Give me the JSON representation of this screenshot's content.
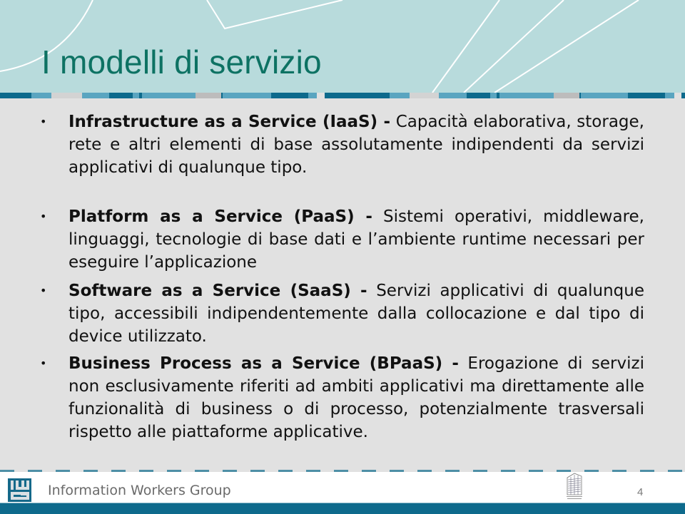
{
  "slide": {
    "title": "I modelli di servizio",
    "bullets": [
      {
        "bold": "Infrastructure as a Service (IaaS) -",
        "text": " Capacità elaborativa, storage, rete e altri elementi di base assolutamente indipendenti da servizi applicativi di qualunque tipo."
      },
      {
        "bold": "Platform as a Service (PaaS)  -",
        "text": " Sistemi operativi, middleware, linguaggi, tecnologie di base dati e l’ambiente runtime necessari per eseguire l’applicazione"
      },
      {
        "bold": "Software as a Service (SaaS) -",
        "text": " Servizi applicativi di qualunque tipo, accessibili indipendentemente dalla collocazione e dal tipo di device utilizzato."
      },
      {
        "bold": "Business Process as a Service (BPaaS) -",
        "text": " Erogazione di servizi non esclusivamente riferiti ad ambiti applicativi ma direttamente alle funzionalità di business o di processo, potenzialmente trasversali rispetto alle piattaforme applicative."
      }
    ],
    "bullet_glyph": "•"
  },
  "footer": {
    "brand": "Information Workers Group",
    "logo_icon": "iwg-logo-icon",
    "building_icon": "building-icon",
    "page_number": "4"
  },
  "colors": {
    "header_bg": "#b8dbdc",
    "title": "#0d7263",
    "content_bg": "#e1e1e1",
    "stripe_dark": "#0d6a8c",
    "stripe_mid": "#5aa5c0",
    "stripe_light": "#d3d3d3",
    "stripe_grey": "#bdbcbc",
    "footer_bar": "#0e6a8c"
  }
}
